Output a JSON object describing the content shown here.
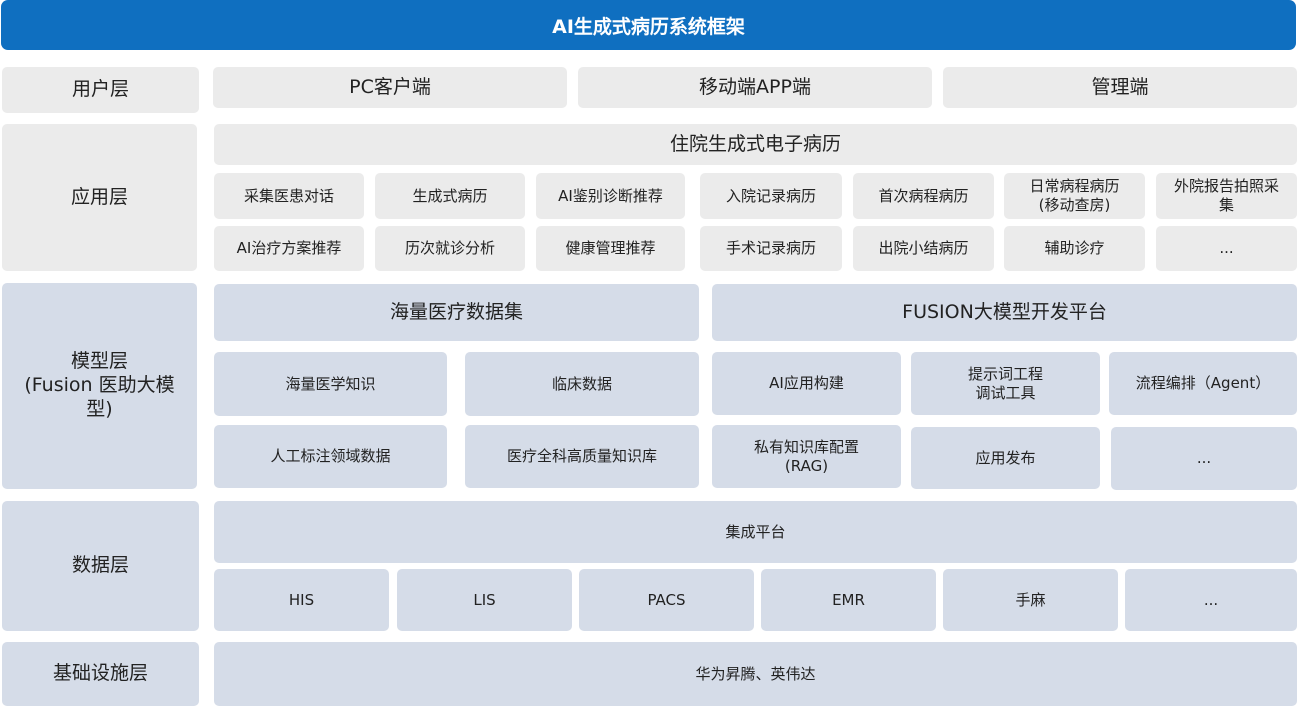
{
  "title": "AI生成式病历系统框架",
  "user_layer": {
    "label": "用户层",
    "items": [
      "PC客户端",
      "移动端APP端",
      "管理端"
    ]
  },
  "app_layer": {
    "label": "应用层",
    "header": "住院生成式电子病历",
    "row1": [
      "采集医患对话",
      "生成式病历",
      "AI鉴别诊断推荐",
      "入院记录病历",
      "首次病程病历",
      "日常病程病历\n(移动查房)",
      "外院报告拍照采\n集"
    ],
    "row2": [
      "AI治疗方案推荐",
      "历次就诊分析",
      "健康管理推荐",
      "手术记录病历",
      "出院小结病历",
      "辅助诊疗",
      "..."
    ]
  },
  "model_layer": {
    "label": "模型层\n(Fusion 医助大模\n型)",
    "dataset_header": "海量医疗数据集",
    "platform_header": "FUSION大模型开发平台",
    "dataset_items": [
      "海量医学知识",
      "临床数据",
      "人工标注领域数据",
      "医疗全科高质量知识库"
    ],
    "platform_items": [
      "AI应用构建",
      "提示词工程\n调试工具",
      "流程编排（Agent）",
      "私有知识库配置\n(RAG)",
      "应用发布",
      "..."
    ]
  },
  "data_layer": {
    "label": "数据层",
    "header": "集成平台",
    "items": [
      "HIS",
      "LIS",
      "PACS",
      "EMR",
      "手麻",
      "..."
    ]
  },
  "infra_layer": {
    "label": "基础设施层",
    "content": "华为昇腾、英伟达"
  },
  "colors": {
    "title_bg": "#0f6fc0",
    "gray_box": "#ebebeb",
    "blue_box": "#d5dce8"
  }
}
